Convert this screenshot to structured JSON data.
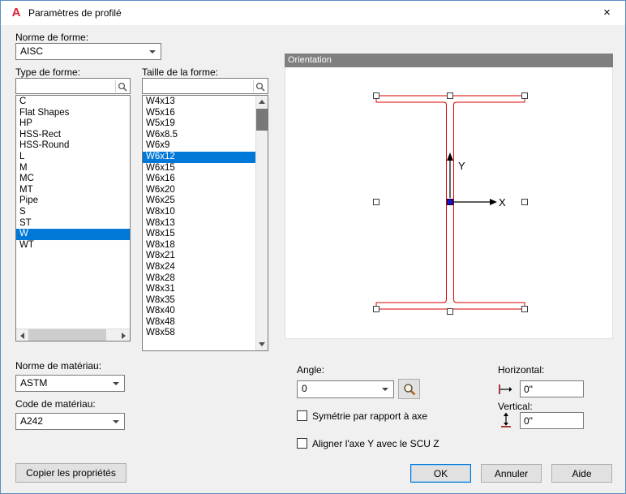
{
  "colors": {
    "selection_bg": "#0078d7",
    "beam_outline": "#dd0000",
    "grip_fill": "#ffffff",
    "center_grip_fill": "#1414c8",
    "orientation_header_bg": "#7f7f7f",
    "dialog_bg": "#f0f0f0",
    "logo_red": "#d92231"
  },
  "window": {
    "title": "Paramètres de profilé",
    "logo_glyph": "A",
    "close_glyph": "×"
  },
  "shape_standard": {
    "label": "Norme de forme:",
    "value": "AISC"
  },
  "shape_type": {
    "label": "Type de forme:",
    "search_value": "",
    "items": [
      "C",
      "Flat Shapes",
      "HP",
      "HSS-Rect",
      "HSS-Round",
      "L",
      "M",
      "MC",
      "MT",
      "Pipe",
      "S",
      "ST",
      "W",
      "WT"
    ],
    "selected": "W"
  },
  "shape_size": {
    "label": "Taille de la forme:",
    "search_value": "",
    "items": [
      "W4x13",
      "W5x16",
      "W5x19",
      "W6x8.5",
      "W6x9",
      "W6x12",
      "W6x15",
      "W6x16",
      "W6x20",
      "W6x25",
      "W8x10",
      "W8x13",
      "W8x15",
      "W8x18",
      "W8x21",
      "W8x24",
      "W8x28",
      "W8x31",
      "W8x35",
      "W8x40",
      "W8x48",
      "W8x58"
    ],
    "selected": "W6x12"
  },
  "orientation": {
    "header": "Orientation",
    "axis_x_label": "X",
    "axis_y_label": "Y"
  },
  "angle": {
    "label": "Angle:",
    "value": "0"
  },
  "options": {
    "mirror_label": "Symétrie par rapport à axe",
    "align_label": "Aligner l'axe Y avec le SCU Z"
  },
  "offsets": {
    "horizontal_label": "Horizontal:",
    "horizontal_value": "0\"",
    "vertical_label": "Vertical:",
    "vertical_value": "0\""
  },
  "material_standard": {
    "label": "Norme de matériau:",
    "value": "ASTM"
  },
  "material_code": {
    "label": "Code de matériau:",
    "value": "A242"
  },
  "actions": {
    "copy_properties": "Copier les propriétés",
    "ok": "OK",
    "cancel": "Annuler",
    "help": "Aide"
  }
}
